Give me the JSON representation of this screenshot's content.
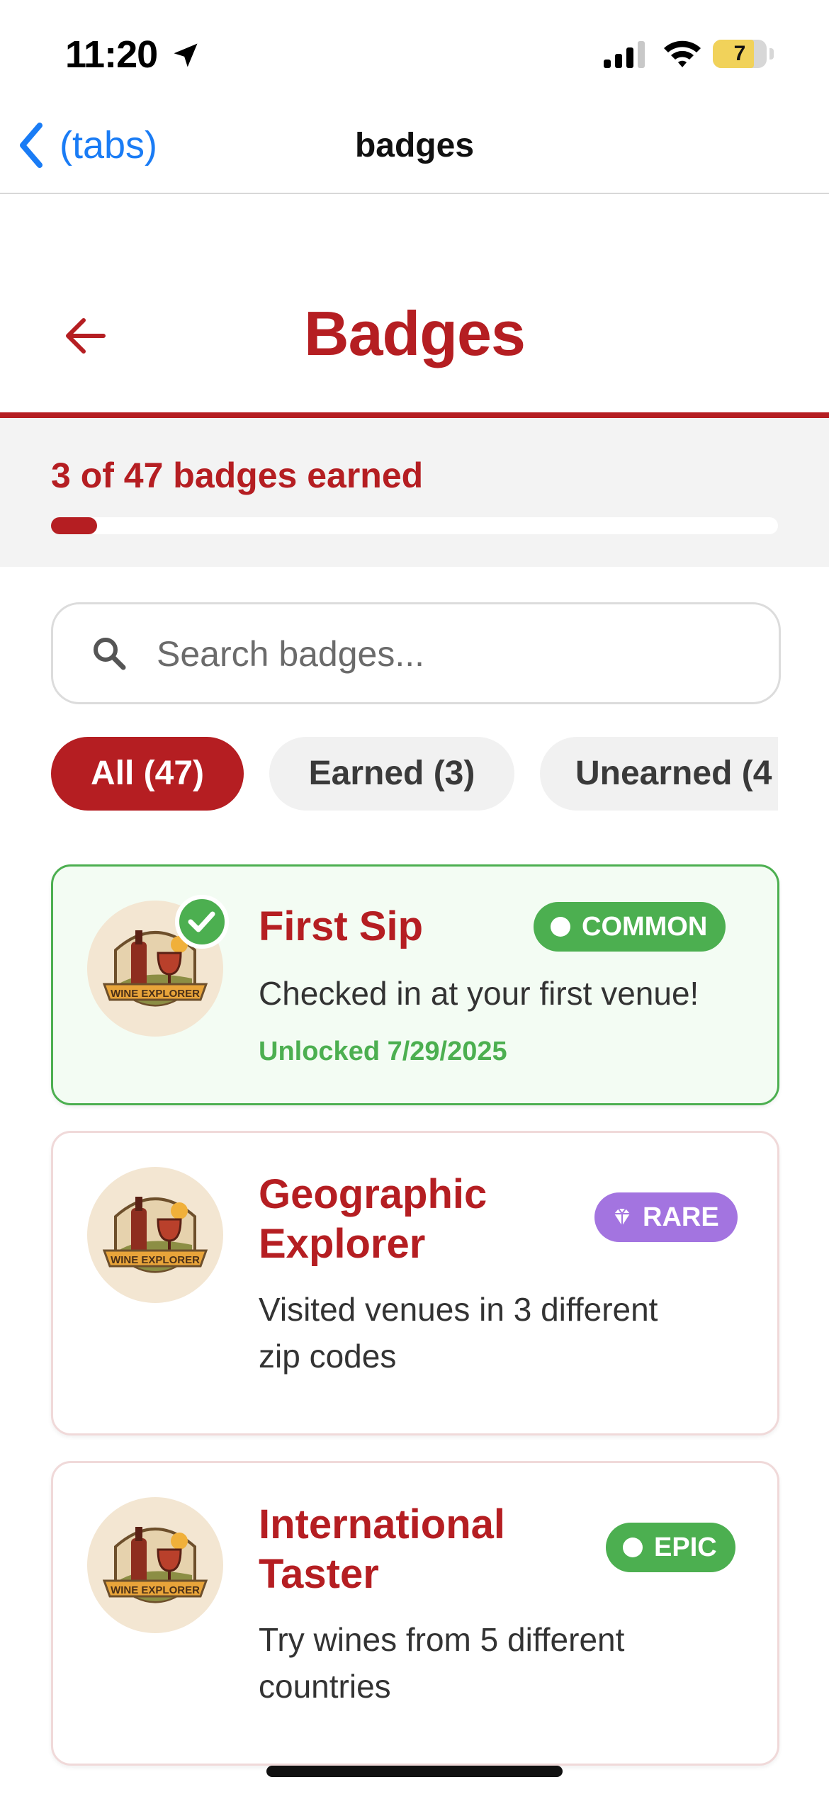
{
  "status_bar": {
    "time": "11:20",
    "battery": "7"
  },
  "nav": {
    "back_label": "(tabs)",
    "title": "badges"
  },
  "header": {
    "title": "Badges"
  },
  "progress": {
    "text": "3 of 47 badges earned",
    "earned": 3,
    "total": 47
  },
  "search": {
    "placeholder": "Search badges..."
  },
  "filters": [
    {
      "label": "All (47)",
      "active": true
    },
    {
      "label": "Earned (3)",
      "active": false
    },
    {
      "label": "Unearned (4",
      "active": false
    }
  ],
  "badges": [
    {
      "title": "First Sip",
      "description": "Checked in at your first venue!",
      "rarity": "COMMON",
      "rarity_color": "#4caf50",
      "rarity_icon": "dot-icon",
      "unlocked": "Unlocked 7/29/2025",
      "earned": true,
      "image_label": "WINE EXPLORER"
    },
    {
      "title_lines": [
        "Geographic",
        "Explorer"
      ],
      "description_lines": [
        "Visited venues in 3 different",
        "zip codes"
      ],
      "rarity": "RARE",
      "rarity_color": "#a374e0",
      "rarity_icon": "gem-icon",
      "earned": false,
      "image_label": "WINE EXPLORER"
    },
    {
      "title_lines": [
        "International",
        "Taster"
      ],
      "description_lines": [
        "Try wines from 5 different",
        "countries"
      ],
      "rarity": "EPIC",
      "rarity_color": "#4caf50",
      "rarity_icon": "dot-icon",
      "earned": false,
      "image_label": "WINE EXPLORER"
    }
  ],
  "colors": {
    "brand": "#b51e22",
    "ios_blue": "#1a7cf5",
    "success": "#4caf50"
  }
}
